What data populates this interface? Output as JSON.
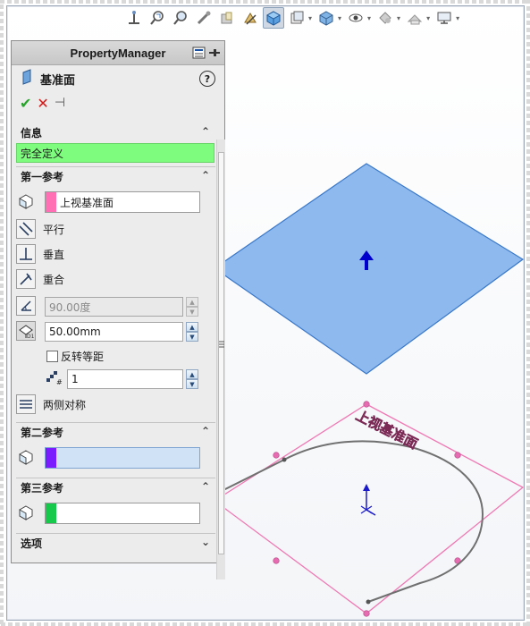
{
  "toolbar": {
    "icons": [
      "view-orientation-icon",
      "zoom-to-fit-icon",
      "zoom-area-icon",
      "previous-view-icon",
      "section-view-icon",
      "view-selector-icon",
      "display-style-icon",
      "hide-show-icon",
      "edit-appearance-icon",
      "apply-scene-icon",
      "view-settings-icon"
    ]
  },
  "property_manager": {
    "title": "PropertyManager",
    "feature_name": "基准面",
    "help_label": "?",
    "ok_label": "✔",
    "cancel_label": "✕",
    "pin_label": "⊣"
  },
  "sections": {
    "info": {
      "header": "信息",
      "message": "完全定义",
      "message_color": "#7dfc7d"
    },
    "first_reference": {
      "header": "第一参考",
      "selected_entity": "上视基准面",
      "swatch_color": "#ff6fb3",
      "constraints": [
        {
          "label": "平行",
          "icon": "parallel-icon"
        },
        {
          "label": "垂直",
          "icon": "perpendicular-icon"
        },
        {
          "label": "重合",
          "icon": "coincident-icon"
        }
      ],
      "angle_value": "90.00度",
      "offset_value": "50.00mm",
      "flip_offset_label": "反转等距",
      "instances_value": "1",
      "mid_plane_label": "两侧对称"
    },
    "second_reference": {
      "header": "第二参考",
      "swatch_color": "#7b1cff"
    },
    "third_reference": {
      "header": "第三参考",
      "swatch_color": "#16c94a"
    },
    "options": {
      "header": "选项"
    }
  },
  "graphics": {
    "plane_label": "上视基准面",
    "new_plane_color": "#8db9ee",
    "reference_plane_color": "#f078b4"
  }
}
